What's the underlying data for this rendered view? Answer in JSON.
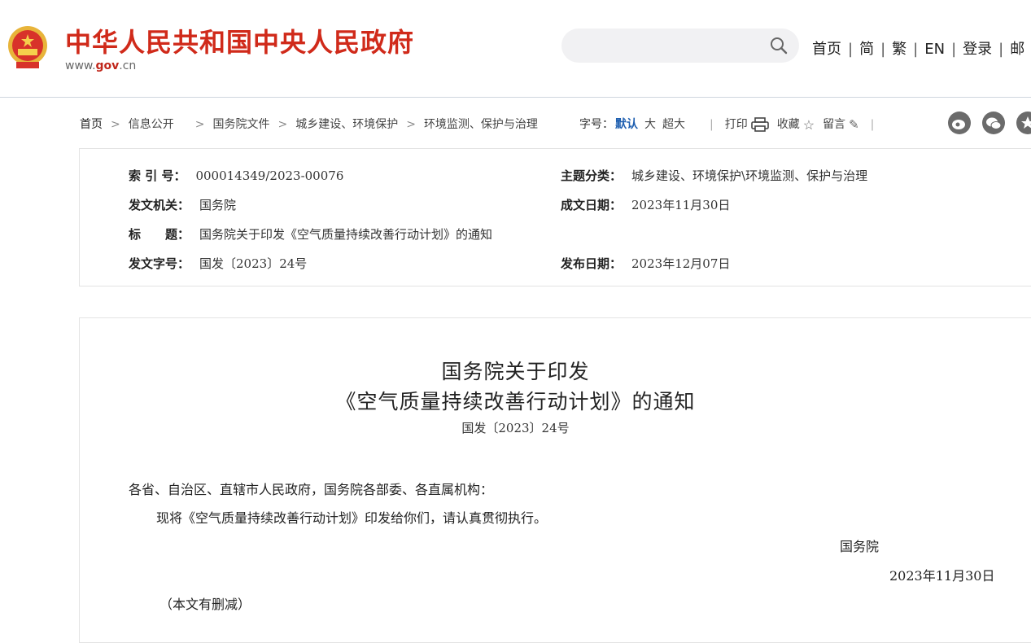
{
  "header": {
    "site_title": "中华人民共和国中央人民政府",
    "site_url_prefix": "www.",
    "site_url_brand": "gov",
    "site_url_suffix": ".cn",
    "search_placeholder": "",
    "links": [
      "首页",
      "简",
      "繁",
      "EN",
      "登录",
      "邮"
    ]
  },
  "breadcrumb": {
    "items": [
      "首页",
      "信息公开",
      "国务院文件",
      "城乡建设、环境保护",
      "环境监测、保护与治理"
    ]
  },
  "toolbar": {
    "font_label": "字号：",
    "font_default": "默认",
    "font_large": "大",
    "font_xlarge": "超大",
    "print": "打印",
    "favorite": "收藏",
    "comment": "留言"
  },
  "meta": {
    "index_label": "索 引 号：",
    "index_value": "000014349/2023-00076",
    "subject_label": "主题分类：",
    "subject_value": "城乡建设、环境保护\\环境监测、保护与治理",
    "issuer_label": "发文机关：",
    "issuer_value": "国务院",
    "written_date_label": "成文日期：",
    "written_date_value": "2023年11月30日",
    "title_label": "标　　题：",
    "title_value": "国务院关于印发《空气质量持续改善行动计划》的通知",
    "doc_number_label": "发文字号：",
    "doc_number_value": "国发〔2023〕24号",
    "publish_date_label": "发布日期：",
    "publish_date_value": "2023年12月07日"
  },
  "document": {
    "title_line1": "国务院关于印发",
    "title_line2": "《空气质量持续改善行动计划》的通知",
    "number": "国发〔2023〕24号",
    "salutation": "各省、自治区、直辖市人民政府，国务院各部委、各直属机构：",
    "paragraph": "现将《空气质量持续改善行动计划》印发给你们，请认真贯彻执行。",
    "signer": "国务院",
    "date": "2023年11月30日",
    "note": "（本文有删减）"
  },
  "colors": {
    "brand_red": "#d02a1a",
    "link_blue": "#1f5fb0"
  }
}
